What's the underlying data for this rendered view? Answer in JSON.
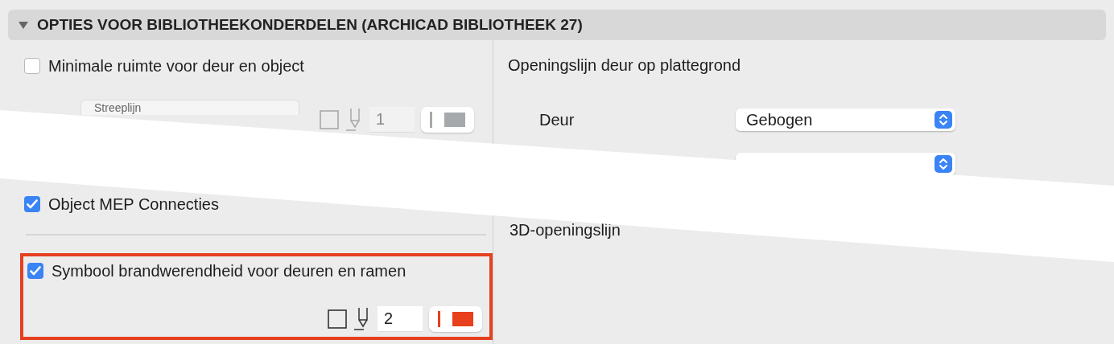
{
  "section": {
    "title": "OPTIES VOOR BIBLIOTHEEKONDERDELEN (ARCHICAD BIBLIOTHEEK 27)",
    "expanded": true
  },
  "min_space": {
    "label": "Minimale ruimte voor deur en object",
    "checked": false,
    "line_type": {
      "label": "Streeplijn"
    },
    "pen": {
      "value": "1",
      "disabled": true,
      "color": "#a5a9ab"
    }
  },
  "mep": {
    "label": "Object MEP Connecties",
    "checked": true
  },
  "fire": {
    "label": "Symbool brandwerendheid voor deuren en ramen",
    "checked": true,
    "highlighted": true,
    "pen": {
      "value": "2",
      "disabled": false,
      "color": "#e8401c"
    }
  },
  "opening_line": {
    "title": "Openingslijn deur op plattegrond",
    "rows": [
      {
        "label": "Deur",
        "value": "Gebogen"
      },
      {}
    ]
  },
  "label_3d": "3D-openingslijn"
}
